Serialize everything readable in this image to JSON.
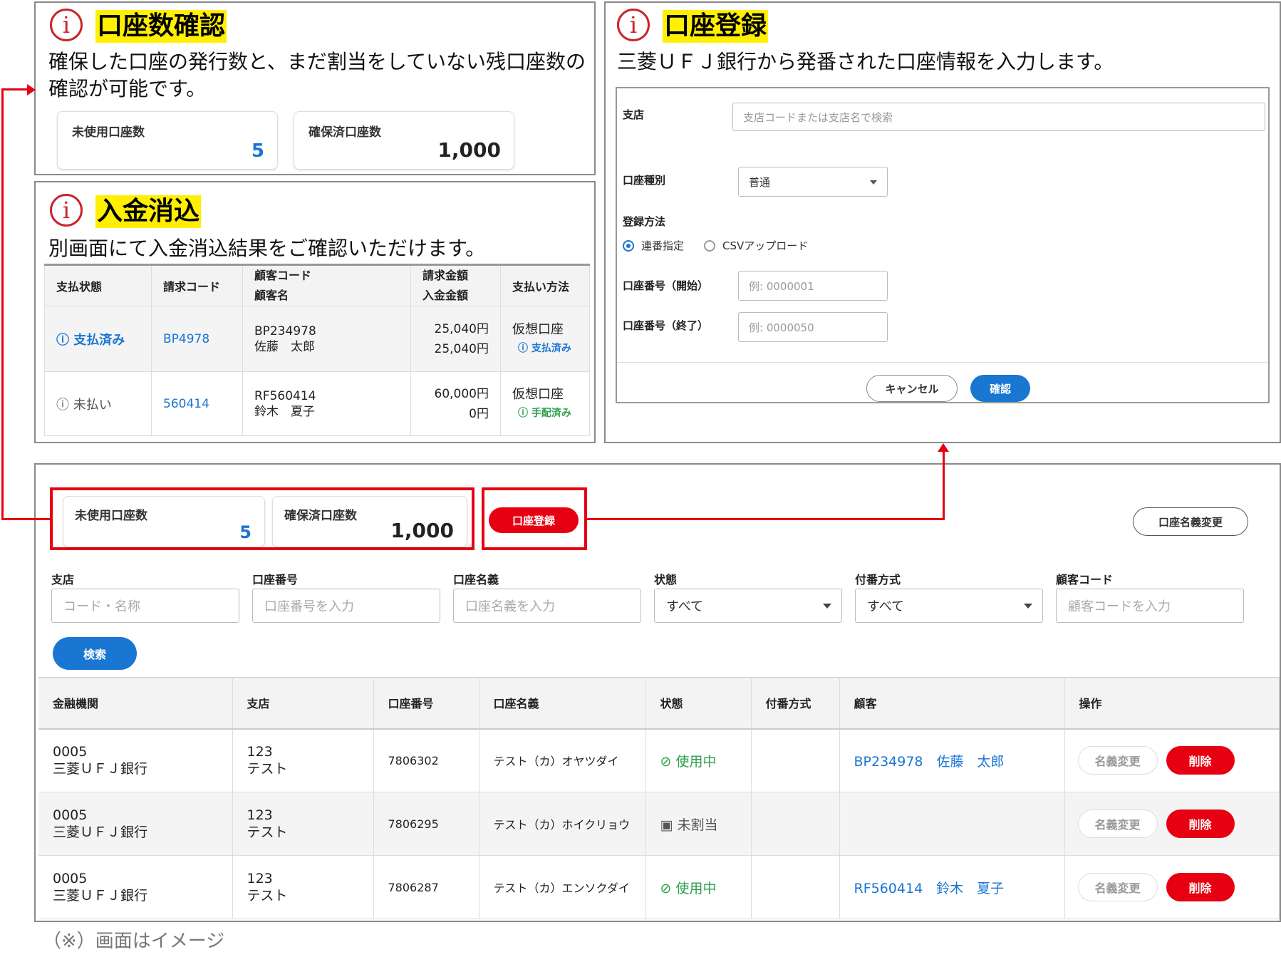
{
  "info_panel_1": {
    "title": "口座数確認",
    "desc_line1": "確保した口座の発行数と、まだ割当をしていない残口座数の",
    "desc_line2": "確認が可能です。",
    "unused_label": "未使用口座数",
    "unused_value": "5",
    "secured_label": "確保済口座数",
    "secured_value": "1,000"
  },
  "info_panel_2": {
    "title": "入金消込",
    "desc": "別画面にて入金消込結果をご確認いただけます。",
    "headers": {
      "status": "支払状態",
      "invoice_code": "請求コード",
      "customer_code": "顧客コード",
      "customer_name": "顧客名",
      "billed": "請求金額",
      "received": "入金金額",
      "method": "支払い方法"
    },
    "rows": [
      {
        "status": "支払済み",
        "invoice": "BP4978",
        "code": "BP234978",
        "name": "佐藤　太郎",
        "billed": "25,040円",
        "received": "25,040円",
        "method": "仮想口座",
        "method_status": "支払済み"
      },
      {
        "status": "未払い",
        "invoice": "560414",
        "code": "RF560414",
        "name": "鈴木　夏子",
        "billed": "60,000円",
        "received": "0円",
        "method": "仮想口座",
        "method_status": "手配済み"
      }
    ]
  },
  "register_panel": {
    "title": "口座登録",
    "desc": "三菱ＵＦＪ銀行から発番された口座情報を入力します。",
    "branch_label": "支店",
    "branch_placeholder": "支店コードまたは支店名で検索",
    "type_label": "口座種別",
    "type_value": "普通",
    "method_label": "登録方法",
    "radio_1": "連番指定",
    "radio_2": "CSVアップロード",
    "start_label": "口座番号（開始）",
    "start_placeholder": "例: 0000001",
    "end_label": "口座番号（終了）",
    "end_placeholder": "例: 0000050",
    "cancel": "キャンセル",
    "confirm": "確認"
  },
  "main": {
    "unused_label": "未使用口座数",
    "unused_value": "5",
    "secured_label": "確保済口座数",
    "secured_value": "1,000",
    "register_button": "口座登録",
    "rename_button": "口座名義変更",
    "filters": [
      {
        "label": "支店",
        "placeholder": "コード・名称"
      },
      {
        "label": "口座番号",
        "placeholder": "口座番号を入力"
      },
      {
        "label": "口座名義",
        "placeholder": "口座名義を入力"
      },
      {
        "label": "状態",
        "value": "すべて"
      },
      {
        "label": "付番方式",
        "value": "すべて"
      },
      {
        "label": "顧客コード",
        "placeholder": "顧客コードを入力"
      }
    ],
    "search_button": "検索",
    "columns": [
      "金融機関",
      "支店",
      "口座番号",
      "口座名義",
      "状態",
      "付番方式",
      "顧客",
      "操作"
    ],
    "rows": [
      {
        "bank_code": "0005",
        "bank_name": "三菱ＵＦＪ銀行",
        "branch_code": "123",
        "branch_name": "テスト",
        "account": "7806302",
        "holder": "テスト（カ）オヤツダイ",
        "status": "使用中",
        "customer": "BP234978　佐藤　太郎"
      },
      {
        "bank_code": "0005",
        "bank_name": "三菱ＵＦＪ銀行",
        "branch_code": "123",
        "branch_name": "テスト",
        "account": "7806295",
        "holder": "テスト（カ）ホイクリョウ",
        "status": "未割当",
        "customer": ""
      },
      {
        "bank_code": "0005",
        "bank_name": "三菱ＵＦＪ銀行",
        "branch_code": "123",
        "branch_name": "テスト",
        "account": "7806287",
        "holder": "テスト（カ）エンソクダイ",
        "status": "使用中",
        "customer": "RF560414　鈴木　夏子"
      }
    ],
    "rename_action": "名義変更",
    "delete_action": "削除"
  },
  "footnote": "（※）画面はイメージ",
  "colors": {
    "accent_red": "#e60012",
    "highlight": "#ffef00",
    "blue": "#1976d2",
    "green": "#2e9e4f"
  }
}
